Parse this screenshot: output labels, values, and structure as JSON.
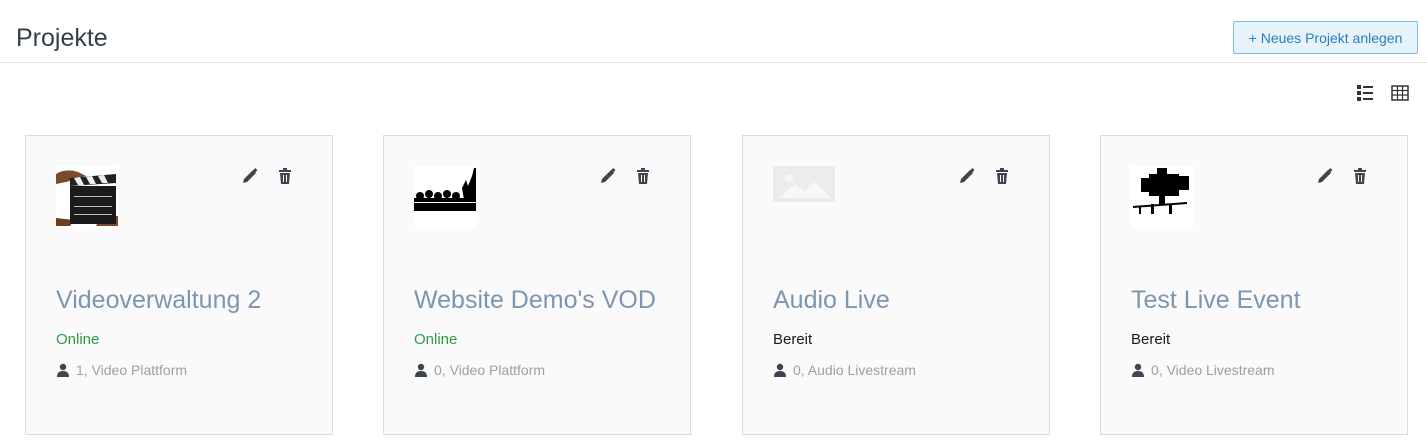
{
  "header": {
    "title": "Projekte",
    "new_project_label": "+ Neues Projekt anlegen"
  },
  "view_toggles": [
    "list-view-icon",
    "grid-view-icon"
  ],
  "colors": {
    "accent": "#2a7fb8",
    "online": "#2d9a46",
    "title": "#7d95b0"
  },
  "projects": [
    {
      "title": "Videoverwaltung 2",
      "status": "Online",
      "meta": "1, Video Plattform",
      "thumbnail_icon": "clapperboard-image"
    },
    {
      "title": "Website Demo's VOD",
      "status": "Online",
      "meta": "0, Video Plattform",
      "thumbnail_icon": "crowd-silhouette-image"
    },
    {
      "title": "Audio Live",
      "status": "Bereit",
      "meta": "0, Audio Livestream",
      "thumbnail_icon": "image-placeholder-icon"
    },
    {
      "title": "Test Live Event",
      "status": "Bereit",
      "meta": "0, Video Livestream",
      "thumbnail_icon": "tv-camera-image"
    }
  ]
}
